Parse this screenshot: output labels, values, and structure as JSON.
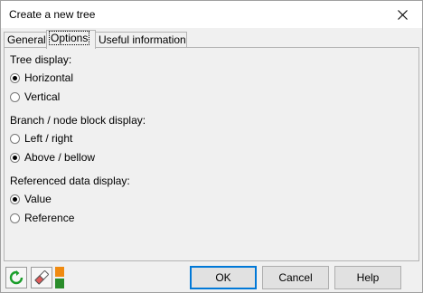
{
  "window": {
    "title": "Create a new tree"
  },
  "tabs": [
    {
      "label": "General",
      "active": false
    },
    {
      "label": "Options",
      "active": true
    },
    {
      "label": "Useful information",
      "active": false
    }
  ],
  "groups": {
    "tree_display": {
      "label": "Tree display:",
      "options": [
        {
          "label": "Horizontal",
          "checked": true
        },
        {
          "label": "Vertical",
          "checked": false
        }
      ]
    },
    "branch_display": {
      "label": "Branch / node block display:",
      "options": [
        {
          "label": "Left / right",
          "checked": false
        },
        {
          "label": "Above / bellow",
          "checked": true
        }
      ]
    },
    "referenced_display": {
      "label": "Referenced data display:",
      "options": [
        {
          "label": "Value",
          "checked": true
        },
        {
          "label": "Reference",
          "checked": false
        }
      ]
    }
  },
  "buttons": {
    "ok": "OK",
    "cancel": "Cancel",
    "help": "Help"
  },
  "icons": {
    "refresh": "refresh-icon",
    "eraser": "eraser-icon",
    "color": "color-swatch-icon"
  },
  "colors": {
    "refresh_green": "#1a9e2a",
    "swatch_orange": "#f08a10",
    "swatch_green": "#2a8c2a",
    "default_border": "#0078d7"
  }
}
